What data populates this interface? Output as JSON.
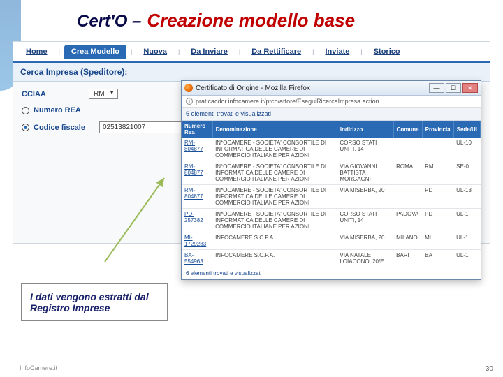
{
  "title": {
    "part1": "Cert'O –",
    "part2": "Creazione modello base"
  },
  "nav": {
    "items": [
      "Home",
      "Crea Modello",
      "Nuova",
      "Da Inviare",
      "Da Rettificare",
      "Inviate",
      "Storico"
    ],
    "active_index": 1
  },
  "panel": {
    "header": "Cerca Impresa (Speditore):",
    "cciaa_label": "CCIAA",
    "cciaa_value": "RM",
    "rea_label": "Numero REA",
    "cf_label": "Codice fiscale",
    "cf_value": "02513821007"
  },
  "popup": {
    "title": "Certificato di Origine - Mozilla Firefox",
    "url": "praticacdor.infocamere.it/ptco/attore/EseguiRicercaImpresa.action",
    "sub": "6 elementi trovati e visualizzati",
    "columns": [
      "Numero Rea",
      "Denominazione",
      "Indirizzo",
      "Comune",
      "Provincia",
      "Sede/Ul"
    ],
    "rows": [
      {
        "rea": "RM-804877",
        "den": "IN*OCAMERE - SOCIETA' CONSORTILE DI INFORMATICA DELLE CAMERE DI COMMERCIO ITALIANE PER AZIONI",
        "ind": "CORSO STATI UNITI, 14",
        "com": "",
        "prov": "",
        "sede": "UL-10"
      },
      {
        "rea": "RM-804877",
        "den": "IN*OCAMERE - SOCIETA' CONSORTILE DI INFORMATICA DELLE CAMERE DI COMMERCIO ITALIANE PER AZIONI",
        "ind": "VIA GIOVANNI BATTISTA MORGAGNI",
        "com": "ROMA",
        "prov": "RM",
        "sede": "SE-0"
      },
      {
        "rea": "RM-804877",
        "den": "IN*OCAMERE - SOCIETA' CONSORTILE DI INFORMATICA DELLE CAMERE DI COMMERCIO ITALIANE PER AZIONI",
        "ind": "VIA MISERBA, 20",
        "com": "",
        "prov": "PD",
        "sede": "UL-13"
      },
      {
        "rea": "PD-257382",
        "den": "IN*OCAMERE - SOCIETA' CONSORTILE DI INFORMATICA DELLE CAMERE DI COMMERCIO ITALIANE PER AZIONI",
        "ind": "CORSO STATI UNITI, 14",
        "com": "PADOVA",
        "prov": "PD",
        "sede": "UL-1"
      },
      {
        "rea": "MI-1729283",
        "den": "INFOCAMERE S.C.P.A.",
        "ind": "VIA MISERBA, 20",
        "com": "MILANO",
        "prov": "MI",
        "sede": "UL-1"
      },
      {
        "rea": "BA-554963",
        "den": "INFOCAMERE S.C.P.A.",
        "ind": "VIA NATALE LOIACONO, 20/E",
        "com": "BARI",
        "prov": "BA",
        "sede": "UL-1"
      }
    ],
    "footer": "6 elementi trovati e visualizzati"
  },
  "callout": "I dati vengono estratti dal Registro Imprese",
  "brand": "InfoCamere.it",
  "page": "30"
}
